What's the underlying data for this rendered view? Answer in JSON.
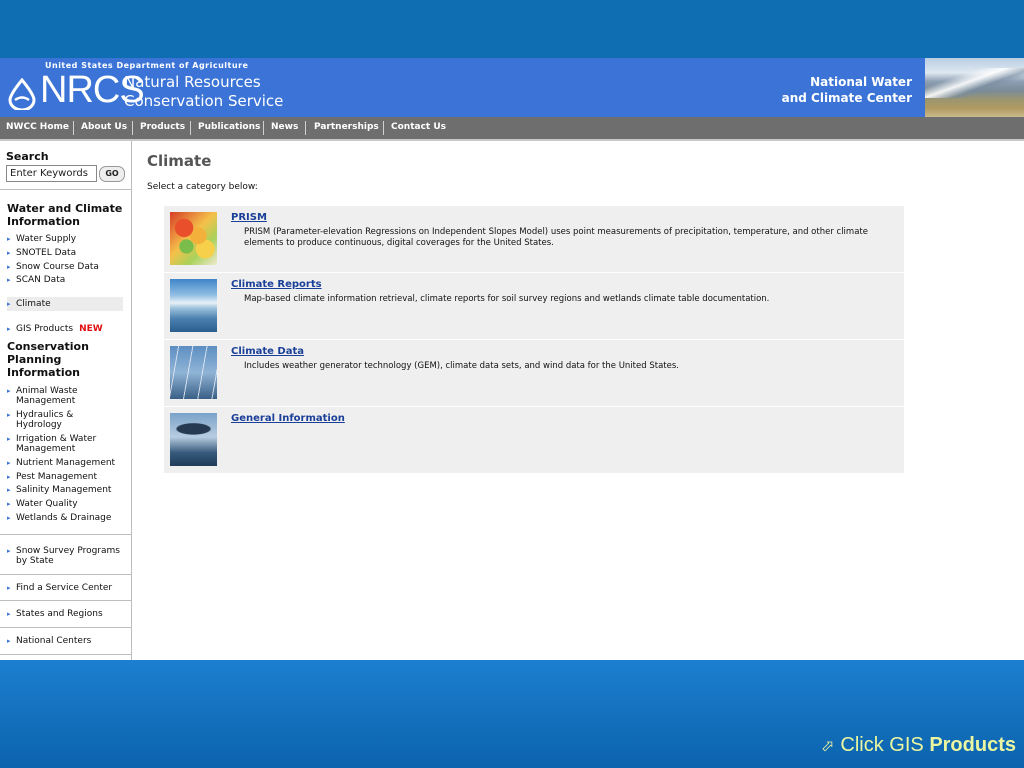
{
  "header": {
    "agency": "United States Department of Agriculture",
    "logo_text": "NRCS",
    "logo_name_line1": "Natural Resources",
    "logo_name_line2": "Conservation Service",
    "center_line1": "National Water",
    "center_line2": "and Climate Center"
  },
  "nav": [
    "NWCC Home",
    "About Us",
    "Products",
    "Publications",
    "News",
    "Partnerships",
    "Contact Us"
  ],
  "search": {
    "label": "Search",
    "placeholder": "Enter Keywords",
    "button": "GO"
  },
  "sidebar": {
    "section1": "Water and Climate Information",
    "items1": [
      "Water Supply",
      "SNOTEL Data",
      "Snow Course Data",
      "SCAN Data",
      "Climate",
      "GIS Products"
    ],
    "new_badge": "NEW",
    "section2": "Conservation Planning Information",
    "items2": [
      "Animal Waste Management",
      "Hydraulics & Hydrology",
      "Irrigation & Water Management",
      "Nutrient Management",
      "Pest Management",
      "Salinity Management",
      "Water Quality",
      "Wetlands & Drainage"
    ],
    "items3": [
      "Snow Survey Programs by State",
      "Find a Service Center",
      "States and Regions",
      "National Centers"
    ]
  },
  "content": {
    "title": "Climate",
    "subtitle": "Select a category below:",
    "cards": [
      {
        "title": "PRISM",
        "desc": "PRISM (Parameter-elevation Regressions on Independent Slopes Model) uses point measurements of precipitation, temperature, and other climate elements to produce continuous, digital coverages for the United States."
      },
      {
        "title": "Climate Reports",
        "desc": "Map-based climate information retrieval, climate reports for soil survey regions and wetlands climate table documentation."
      },
      {
        "title": "Climate Data",
        "desc": "Includes weather generator technology (GEM), climate data sets, and wind data for the United States."
      },
      {
        "title": "General Information",
        "desc": ""
      }
    ]
  },
  "caption": {
    "prefix": "Click GIS",
    "bold": "Products",
    "icon": "arrow-link-icon"
  }
}
